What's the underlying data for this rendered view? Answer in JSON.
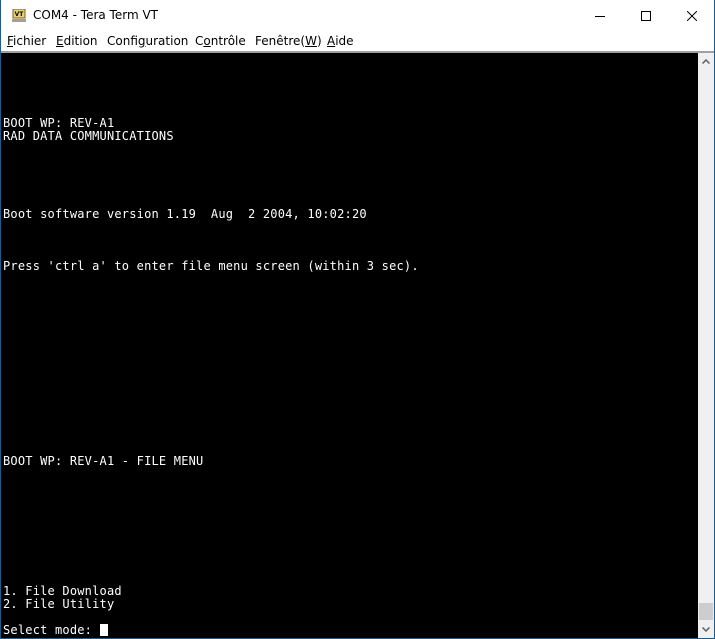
{
  "window": {
    "title": "COM4 - Tera Term VT",
    "app_icon": "vt-terminal-icon",
    "controls": {
      "minimize": "minimize-icon",
      "maximize": "maximize-icon",
      "close": "close-icon"
    }
  },
  "menubar": {
    "items": [
      {
        "label": "Fichier",
        "accel": "F",
        "rest": "ichier"
      },
      {
        "label": "Edition",
        "accel": "E",
        "rest": "dition"
      },
      {
        "label": "Configuration",
        "pre": "Confi",
        "accel": "g",
        "rest": "uration"
      },
      {
        "label": "Contrôle",
        "pre": "C",
        "accel": "o",
        "rest": "ntrôle"
      },
      {
        "label": "Fenêtre(W)",
        "pre": "Fenêtre(",
        "accel": "W",
        "rest": ")"
      },
      {
        "label": "Aide",
        "accel": "A",
        "rest": "ide"
      }
    ]
  },
  "terminal": {
    "lines": [
      "BOOT WP: REV-A1",
      "RAD DATA COMMUNICATIONS",
      "Boot software version 1.19  Aug  2 2004, 10:02:20",
      "Press 'ctrl a' to enter file menu screen (within 3 sec).",
      "BOOT WP: REV-A1 - FILE MENU",
      "1. File Download",
      "2. File Utility",
      "Select mode: "
    ],
    "foreground": "#ffffff",
    "background": "#000000"
  },
  "scrollbar": {
    "position": "bottom",
    "up_icon": "scroll-up-arrow-icon",
    "down_icon": "scroll-down-arrow-icon"
  }
}
